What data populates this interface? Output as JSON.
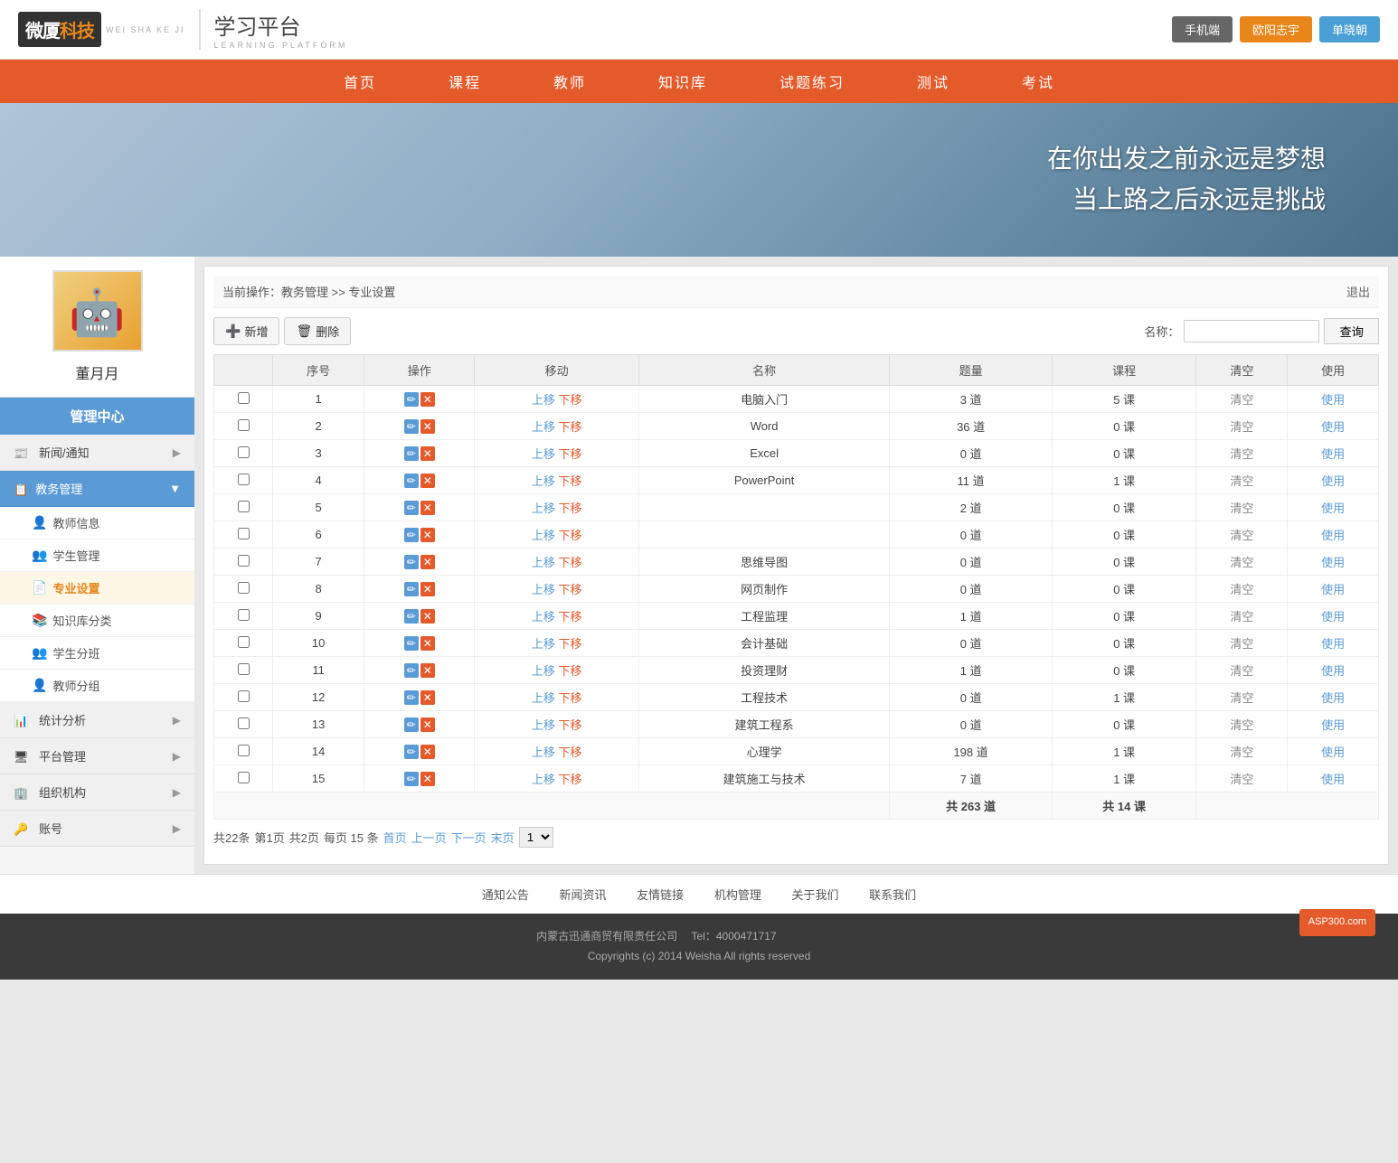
{
  "header": {
    "logo": "微厦科技",
    "logo_en": "WEI SHA KE JI",
    "platform": "学习平台",
    "platform_en": "LEARNING PLATFORM",
    "btn_mobile": "手机端",
    "btn_user": "欧阳志宇",
    "btn_username": "单晓朝"
  },
  "nav": {
    "items": [
      "首页",
      "课程",
      "教师",
      "知识库",
      "试题练习",
      "测试",
      "考试"
    ]
  },
  "banner": {
    "line1": "在你出发之前永远是梦想",
    "line2": "当上路之后永远是挑战"
  },
  "sidebar": {
    "username": "董月月",
    "menu_center": "管理中心",
    "items": [
      {
        "id": "news",
        "label": "新闻/通知",
        "icon": "📰",
        "has_arrow": true
      },
      {
        "id": "education",
        "label": "教务管理",
        "icon": "📋",
        "active": true,
        "has_arrow": true
      },
      {
        "id": "statistics",
        "label": "统计分析",
        "icon": "📊",
        "has_arrow": true
      },
      {
        "id": "platform",
        "label": "平台管理",
        "icon": "🖥",
        "has_arrow": true
      },
      {
        "id": "org",
        "label": "组织机构",
        "icon": "🏢",
        "has_arrow": true
      },
      {
        "id": "account",
        "label": "账号",
        "icon": "🔑",
        "has_arrow": true
      }
    ],
    "sub_items": [
      {
        "id": "teacher-info",
        "label": "教师信息",
        "icon": "👤"
      },
      {
        "id": "student-mgmt",
        "label": "学生管理",
        "icon": "👥"
      },
      {
        "id": "major-settings",
        "label": "专业设置",
        "icon": "📄",
        "active": true
      },
      {
        "id": "knowledge-category",
        "label": "知识库分类",
        "icon": "📚"
      },
      {
        "id": "student-group",
        "label": "学生分班",
        "icon": "👥"
      },
      {
        "id": "teacher-group",
        "label": "教师分组",
        "icon": "👤"
      }
    ]
  },
  "breadcrumb": {
    "text": "当前操作：教务管理 >> 专业设置",
    "logout": "退出"
  },
  "toolbar": {
    "add_label": "新增",
    "delete_label": "删除",
    "search_label": "名称：",
    "search_btn": "查询"
  },
  "table": {
    "headers": [
      "",
      "序号",
      "操作",
      "移动",
      "名称",
      "题量",
      "课程",
      "清空",
      "使用"
    ],
    "rows": [
      {
        "num": 1,
        "name": "电脑入门",
        "questions": "3 道",
        "courses": "5 课",
        "has_clear": true,
        "use": "使用"
      },
      {
        "num": 2,
        "name": "Word",
        "questions": "36 道",
        "courses": "0 课",
        "has_clear": true,
        "use": "使用"
      },
      {
        "num": 3,
        "name": "Excel",
        "questions": "0 道",
        "courses": "0 课",
        "has_clear": true,
        "use": "使用"
      },
      {
        "num": 4,
        "name": "PowerPoint",
        "questions": "11 道",
        "courses": "1 课",
        "has_clear": true,
        "use": "使用"
      },
      {
        "num": 5,
        "name": "",
        "questions": "2 道",
        "courses": "0 课",
        "has_clear": true,
        "use": "使用"
      },
      {
        "num": 6,
        "name": "",
        "questions": "0 道",
        "courses": "0 课",
        "has_clear": true,
        "use": "使用"
      },
      {
        "num": 7,
        "name": "思维导图",
        "questions": "0 道",
        "courses": "0 课",
        "has_clear": true,
        "use": "使用"
      },
      {
        "num": 8,
        "name": "网页制作",
        "questions": "0 道",
        "courses": "0 课",
        "has_clear": true,
        "use": "使用"
      },
      {
        "num": 9,
        "name": "工程监理",
        "questions": "1 道",
        "courses": "0 课",
        "has_clear": true,
        "use": "使用"
      },
      {
        "num": 10,
        "name": "会计基础",
        "questions": "0 道",
        "courses": "0 课",
        "has_clear": true,
        "use": "使用"
      },
      {
        "num": 11,
        "name": "投资理财",
        "questions": "1 道",
        "courses": "0 课",
        "has_clear": true,
        "use": "使用"
      },
      {
        "num": 12,
        "name": "工程技术",
        "questions": "0 道",
        "courses": "1 课",
        "has_clear": true,
        "use": "使用"
      },
      {
        "num": 13,
        "name": "建筑工程系",
        "questions": "0 道",
        "courses": "0 课",
        "has_clear": true,
        "use": "使用"
      },
      {
        "num": 14,
        "name": "心理学",
        "questions": "198 道",
        "courses": "1 课",
        "has_clear": true,
        "use": "使用"
      },
      {
        "num": 15,
        "name": "建筑施工与技术",
        "questions": "7 道",
        "courses": "1 课",
        "has_clear": true,
        "use": "使用"
      }
    ],
    "summary": {
      "total_questions": "共 263 道",
      "total_courses": "共 14 课"
    }
  },
  "pagination": {
    "total": "共22条",
    "current_page": "第1页",
    "total_pages": "共2页",
    "per_page": "每页 15 条",
    "first": "首页",
    "prev": "上一页",
    "next": "下一页",
    "last": "末页",
    "page_num": "1"
  },
  "footer": {
    "links": [
      "通知公告",
      "新闻资讯",
      "友情链接",
      "机构管理",
      "关于我们",
      "联系我们"
    ],
    "company": "内蒙古迅通商贸有限责任公司",
    "tel": "Tel：4000471717",
    "copyright": "Copyrights (c) 2014 Weisha All rights reserved"
  }
}
